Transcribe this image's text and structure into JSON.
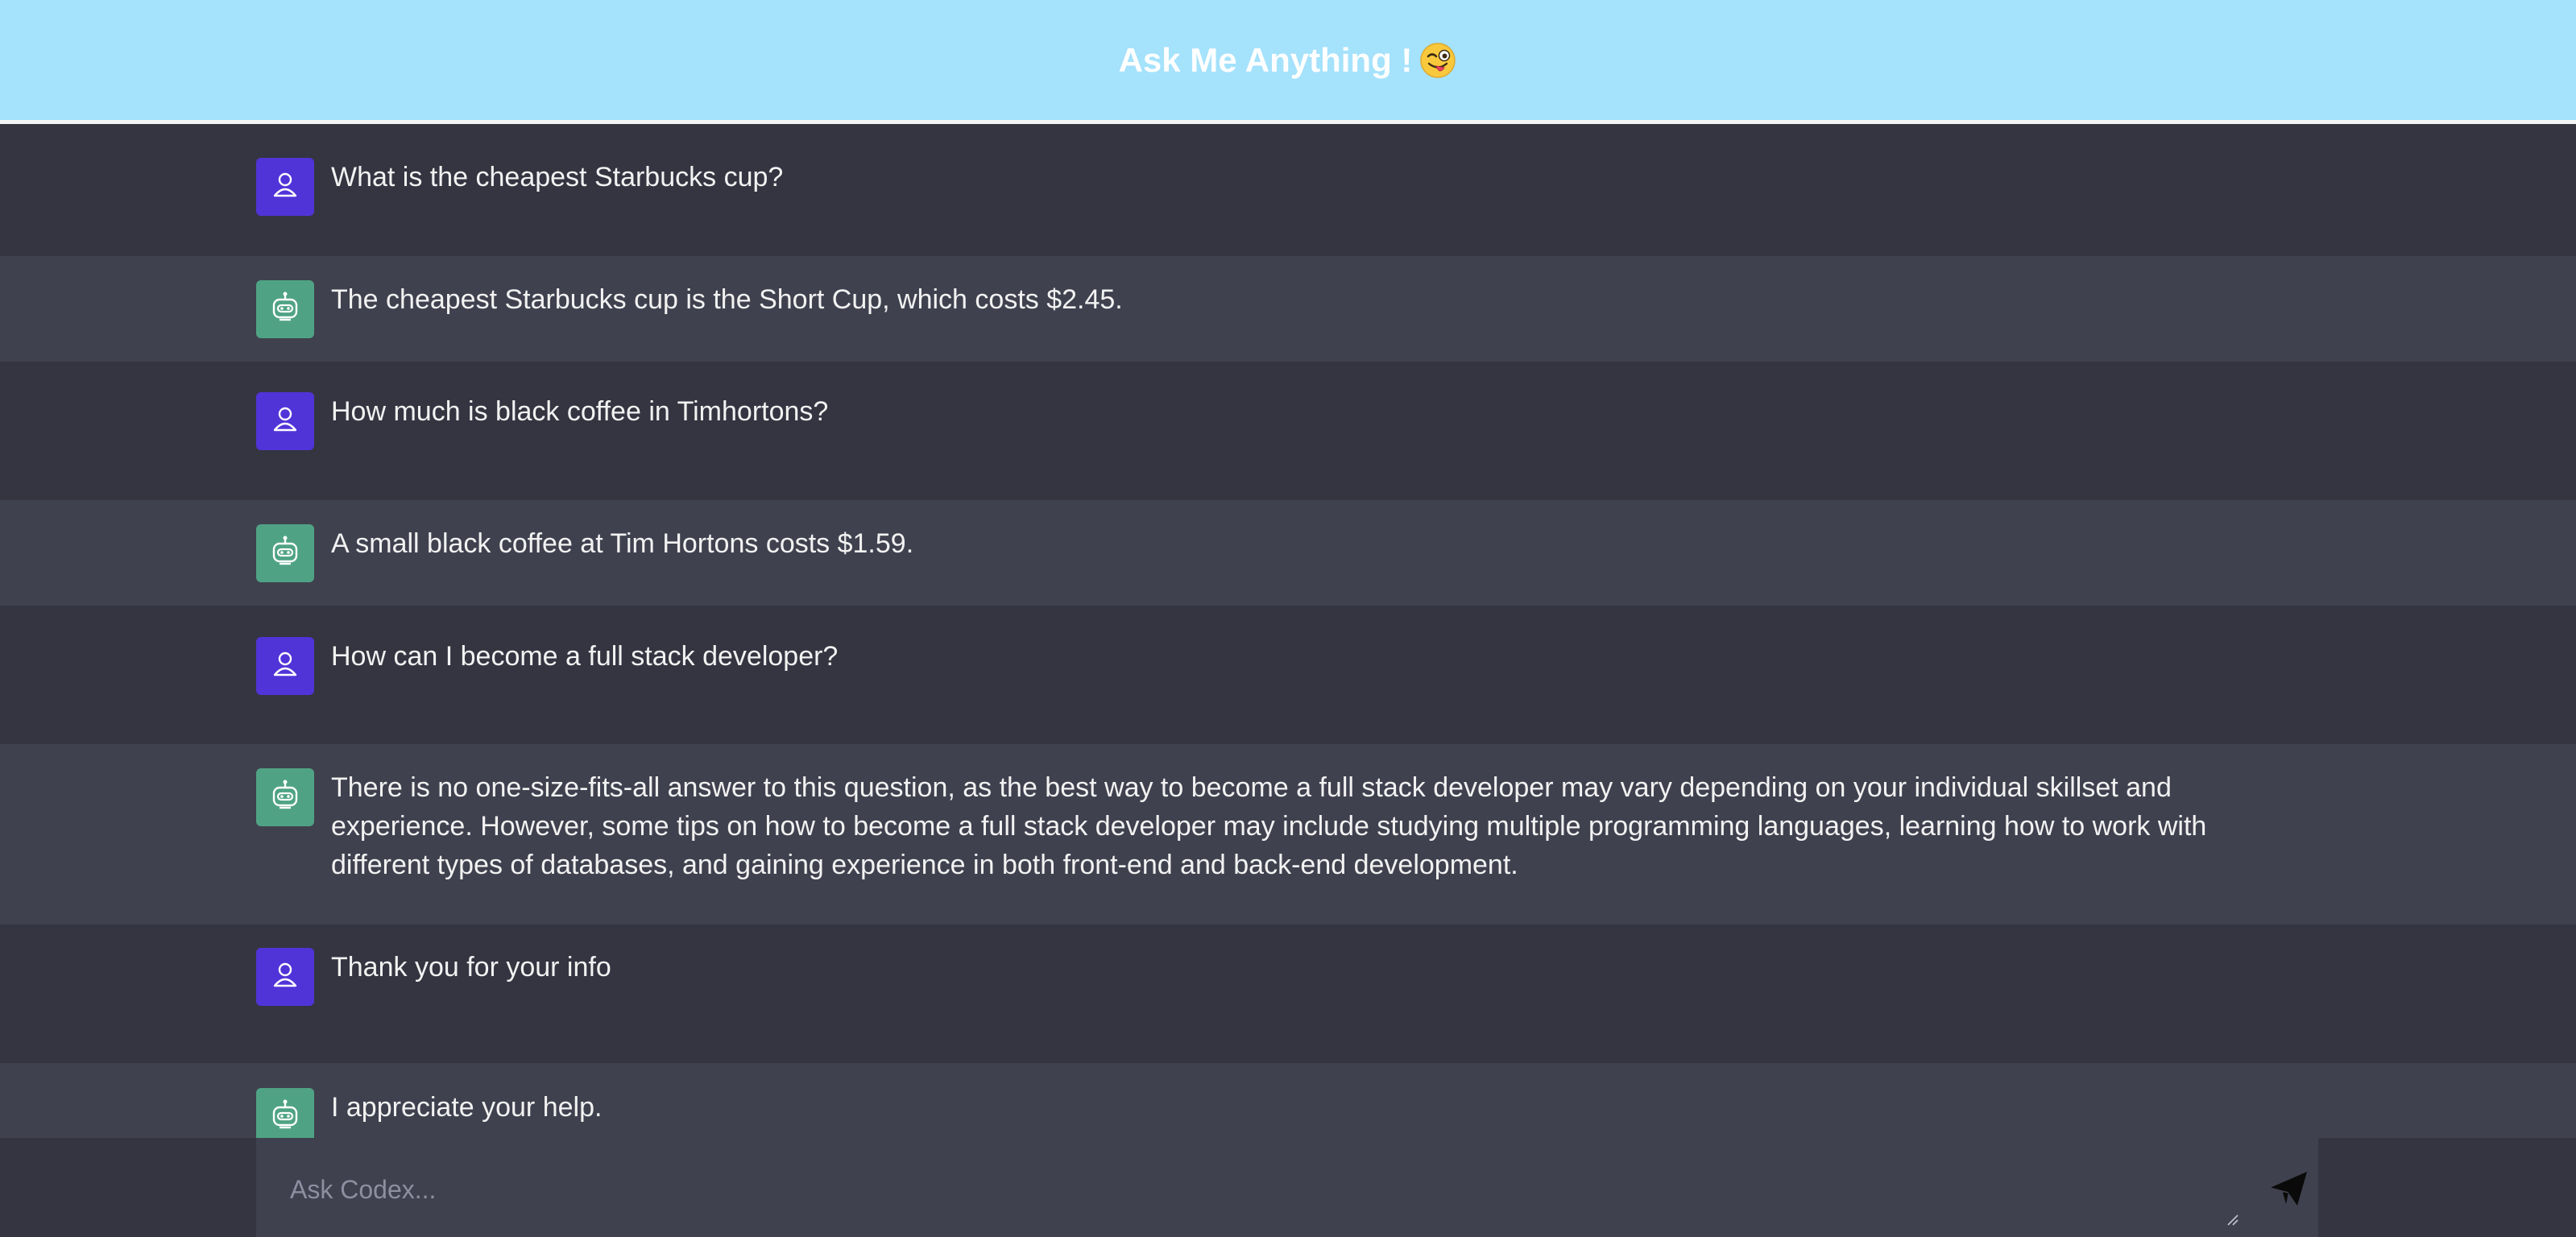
{
  "header": {
    "title": "Ask Me Anything !",
    "emoji_icon": "winking-tongue-face-icon",
    "background": "#a5e2fc"
  },
  "colors": {
    "user_avatar": "#5134d8",
    "ai_avatar": "#4fa384",
    "user_row": "#343541",
    "ai_row": "#40414f"
  },
  "messages": [
    {
      "role": "user",
      "icon": "user-icon",
      "text": "What is the cheapest Starbucks cup?"
    },
    {
      "role": "ai",
      "icon": "robot-icon",
      "text": "The cheapest Starbucks cup is the Short Cup, which costs $2.45."
    },
    {
      "role": "user",
      "icon": "user-icon",
      "text": "How much is black coffee in Timhortons?"
    },
    {
      "role": "ai",
      "icon": "robot-icon",
      "text": "A small black coffee at Tim Hortons costs $1.59."
    },
    {
      "role": "user",
      "icon": "user-icon",
      "text": "How can I become a full stack developer?"
    },
    {
      "role": "ai",
      "icon": "robot-icon",
      "text": "There is no one-size-fits-all answer to this question, as the best way to become a full stack developer may vary depending on your individual skillset and experience. However, some tips on how to become a full stack developer may include studying multiple programming languages, learning how to work with different types of databases, and gaining experience in both front-end and back-end development."
    },
    {
      "role": "user",
      "icon": "user-icon",
      "text": "Thank you for your info"
    },
    {
      "role": "ai",
      "icon": "robot-icon",
      "text": "I appreciate your help."
    }
  ],
  "composer": {
    "placeholder": "Ask Codex...",
    "value": "",
    "send_icon": "paper-plane-icon"
  }
}
